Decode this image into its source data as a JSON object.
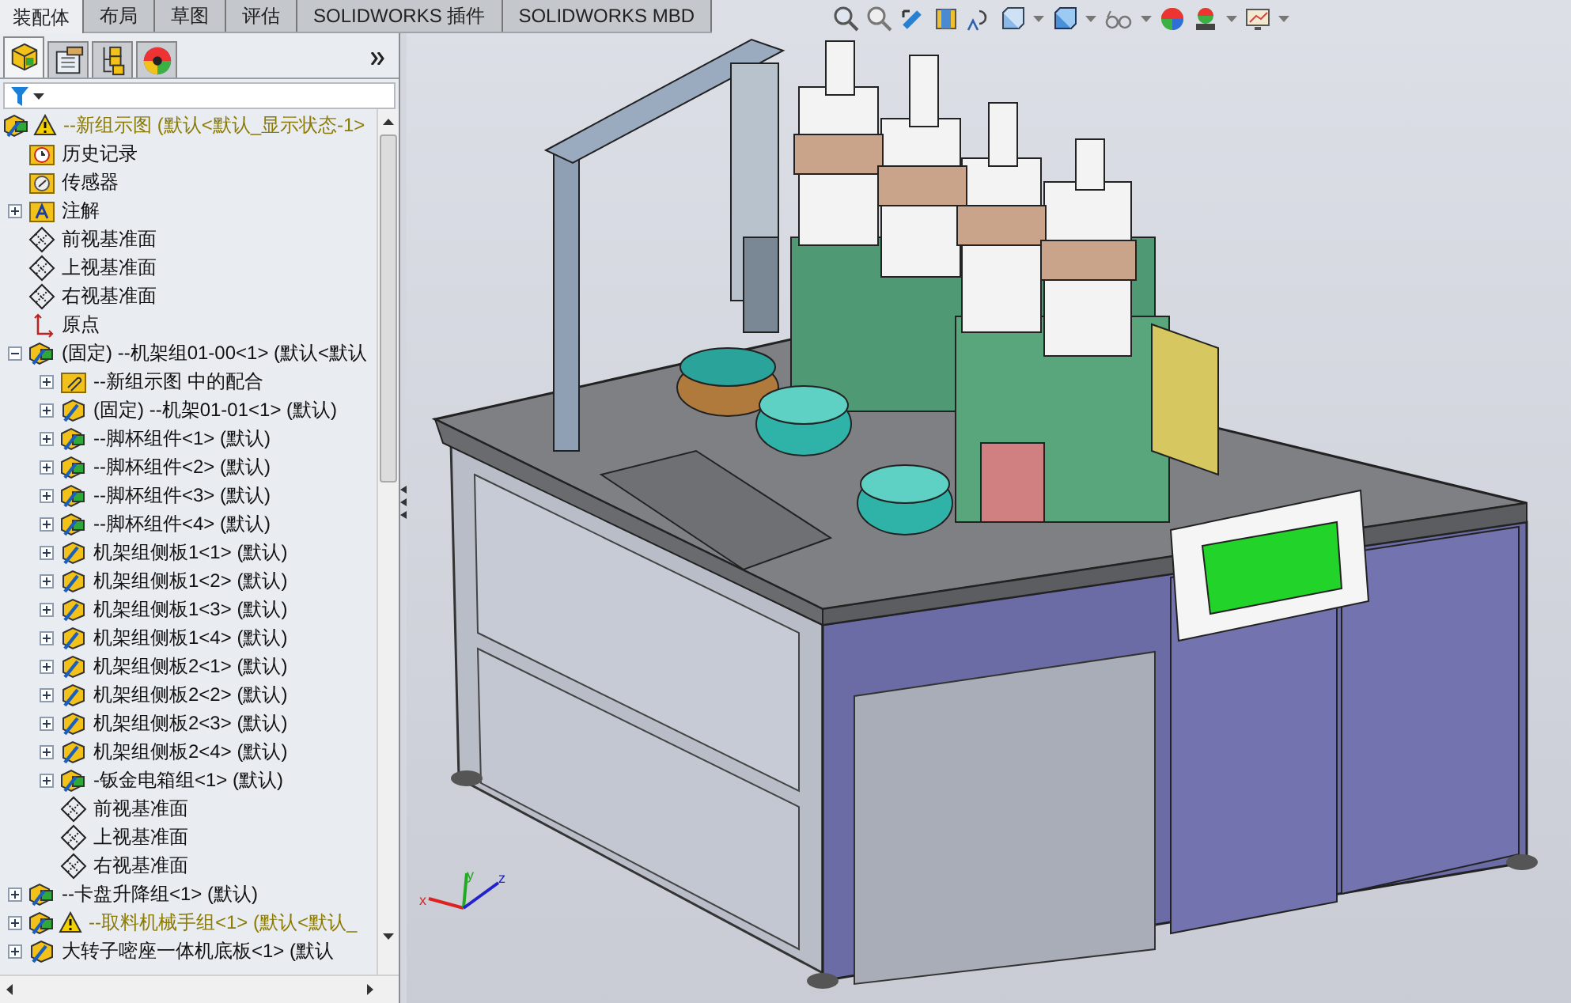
{
  "tabs": [
    {
      "label": "装配体",
      "selected": true
    },
    {
      "label": "布局",
      "selected": false
    },
    {
      "label": "草图",
      "selected": false
    },
    {
      "label": "评估",
      "selected": false
    },
    {
      "label": "SOLIDWORKS 插件",
      "selected": false
    },
    {
      "label": "SOLIDWORKS MBD",
      "selected": false
    }
  ],
  "axis_triad": {
    "x": "x",
    "y": "y",
    "z": "z"
  },
  "panel_tabs": [
    {
      "kind": "tree",
      "selected": true
    },
    {
      "kind": "property",
      "selected": false
    },
    {
      "kind": "config",
      "selected": false
    },
    {
      "kind": "display",
      "selected": false
    }
  ],
  "tree": [
    {
      "kind": "assembly",
      "warning": true,
      "label": "--新组示图  (默认<默认_显示状态-1>",
      "children": [
        {
          "kind": "history",
          "label": "历史记录"
        },
        {
          "kind": "sensor",
          "label": "传感器"
        },
        {
          "kind": "annotation",
          "label": "注解",
          "expanded": false
        },
        {
          "kind": "plane",
          "label": "前视基准面"
        },
        {
          "kind": "plane",
          "label": "上视基准面"
        },
        {
          "kind": "plane",
          "label": "右视基准面"
        },
        {
          "kind": "origin",
          "label": "原点"
        },
        {
          "kind": "assembly",
          "label": "(固定) --机架组01-00<1> (默认<默认",
          "expanded": true,
          "children": [
            {
              "kind": "mates",
              "label": "--新组示图 中的配合",
              "expanded": false
            },
            {
              "kind": "part",
              "label": "(固定) --机架01-01<1> (默认)",
              "expanded": false
            },
            {
              "kind": "assembly",
              "label": "--脚杯组件<1> (默认)",
              "expanded": false
            },
            {
              "kind": "assembly",
              "label": "--脚杯组件<2> (默认)",
              "expanded": false
            },
            {
              "kind": "assembly",
              "label": "--脚杯组件<3> (默认)",
              "expanded": false
            },
            {
              "kind": "assembly",
              "label": "--脚杯组件<4> (默认)",
              "expanded": false
            },
            {
              "kind": "part",
              "label": "机架组侧板1<1> (默认)",
              "expanded": false
            },
            {
              "kind": "part",
              "label": "机架组侧板1<2> (默认)",
              "expanded": false
            },
            {
              "kind": "part",
              "label": "机架组侧板1<3> (默认)",
              "expanded": false
            },
            {
              "kind": "part",
              "label": "机架组侧板1<4> (默认)",
              "expanded": false
            },
            {
              "kind": "part",
              "label": "机架组侧板2<1> (默认)",
              "expanded": false
            },
            {
              "kind": "part",
              "label": "机架组侧板2<2> (默认)",
              "expanded": false
            },
            {
              "kind": "part",
              "label": "机架组侧板2<3> (默认)",
              "expanded": false
            },
            {
              "kind": "part",
              "label": "机架组侧板2<4> (默认)",
              "expanded": false
            },
            {
              "kind": "assembly",
              "label": "-钣金电箱组<1> (默认)",
              "expanded": false
            },
            {
              "kind": "plane",
              "label": "前视基准面"
            },
            {
              "kind": "plane",
              "label": "上视基准面"
            },
            {
              "kind": "plane",
              "label": "右视基准面"
            }
          ]
        },
        {
          "kind": "assembly",
          "label": "--卡盘升降组<1> (默认)",
          "expanded": false
        },
        {
          "kind": "assembly",
          "warning": true,
          "label": "--取料机械手组<1> (默认<默认_",
          "expanded": false
        },
        {
          "kind": "part",
          "label": "大转子嘧座一体机底板<1> (默认",
          "expanded": false
        }
      ]
    }
  ]
}
